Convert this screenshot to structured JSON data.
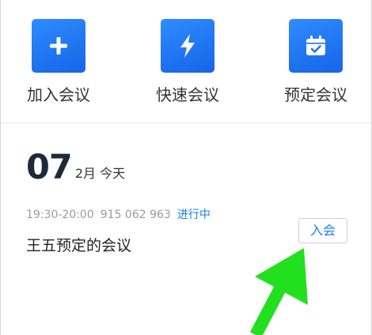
{
  "actions": {
    "join_label": "加入会议",
    "quick_label": "快速会议",
    "schedule_label": "预定会议"
  },
  "meeting_date": {
    "day": "07",
    "month_today": "2月 今天"
  },
  "meeting": {
    "time": "19:30-20:00",
    "meeting_id": "915 062 963",
    "status": "进行中",
    "title": "王五预定的会议",
    "join_button": "入会"
  },
  "colors": {
    "accent_blue": "#1a7df0",
    "tile_blue": "#1f74f0",
    "annotation_green": "#22e01e"
  },
  "icons": {
    "join": "plus-icon",
    "quick": "lightning-icon",
    "schedule": "calendar-check-icon"
  }
}
